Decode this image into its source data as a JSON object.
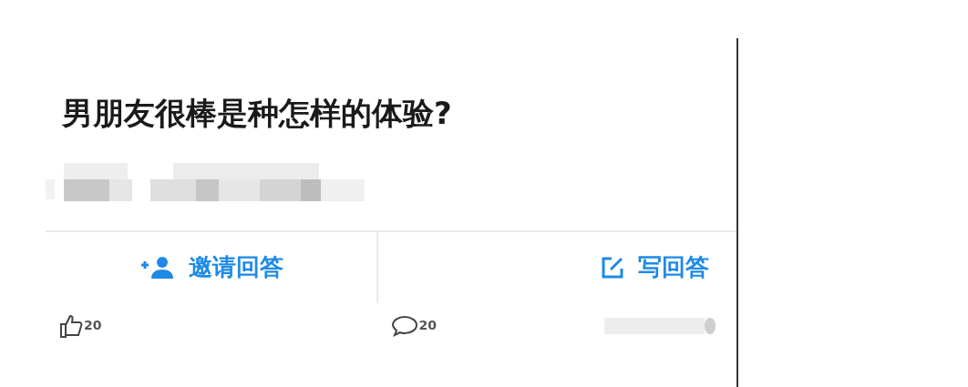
{
  "question": {
    "title": "男朋友很棒是种怎样的体验?"
  },
  "actions": [
    {
      "kind": "invite",
      "label": "邀请回答"
    },
    {
      "kind": "write",
      "label": "写回答"
    }
  ],
  "footer": {
    "likes": "20",
    "comments": "20"
  }
}
